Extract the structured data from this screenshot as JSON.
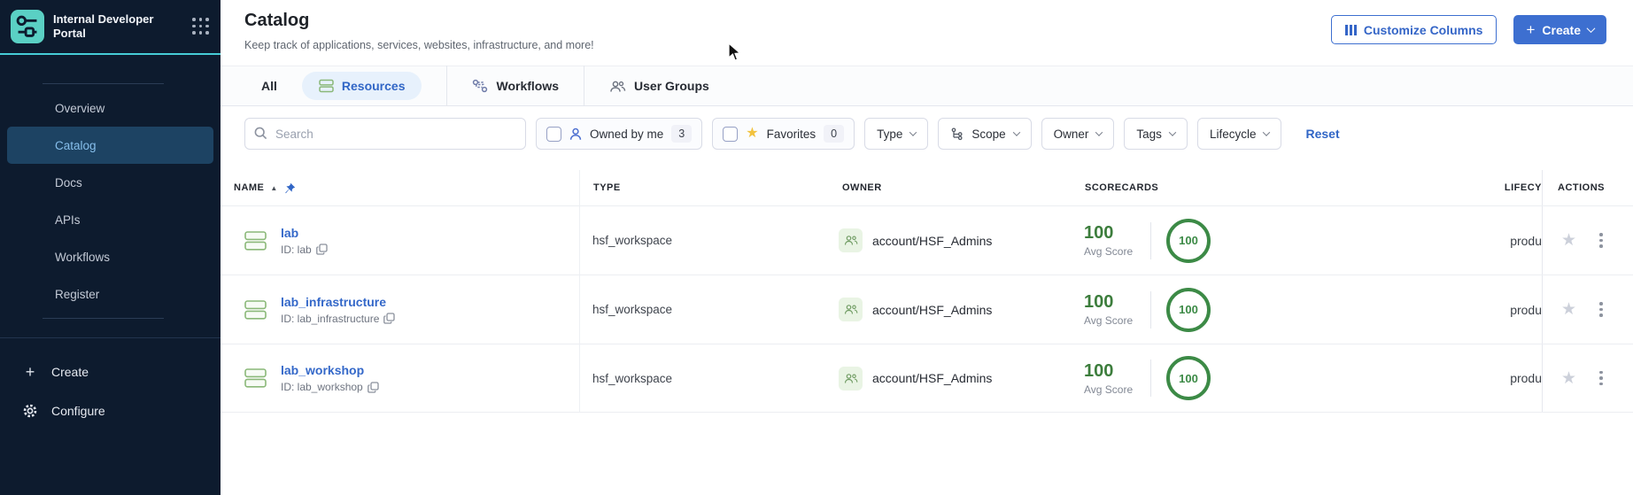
{
  "colors": {
    "sidebar_bg": "#0d1b2e",
    "accent_teal": "#46ccd6",
    "accent_blue": "#3d6fd0",
    "link_blue": "#3468c9",
    "score_green": "#3c8a46",
    "entity_green": "#8ab878",
    "favorite_gold": "#f2c23e"
  },
  "sidebar": {
    "title": "Internal Developer Portal",
    "items": [
      {
        "label": "Overview"
      },
      {
        "label": "Catalog"
      },
      {
        "label": "Docs"
      },
      {
        "label": "APIs"
      },
      {
        "label": "Workflows"
      },
      {
        "label": "Register"
      }
    ],
    "footer": {
      "create_label": "Create",
      "configure_label": "Configure"
    }
  },
  "header": {
    "title": "Catalog",
    "subtitle": "Keep track of applications, services, websites, infrastructure, and more!",
    "customize_columns_label": "Customize Columns",
    "create_label": "Create"
  },
  "tabs": [
    {
      "label": "All"
    },
    {
      "label": "Resources"
    },
    {
      "label": "Workflows"
    },
    {
      "label": "User Groups"
    }
  ],
  "filters": {
    "search_placeholder": "Search",
    "owned_by_me": {
      "label": "Owned by me",
      "count": "3"
    },
    "favorites": {
      "label": "Favorites",
      "count": "0"
    },
    "dropdowns": [
      {
        "label": "Type"
      },
      {
        "label": "Scope"
      },
      {
        "label": "Owner"
      },
      {
        "label": "Tags"
      },
      {
        "label": "Lifecycle"
      }
    ],
    "reset_label": "Reset"
  },
  "table": {
    "headers": {
      "name": "NAME",
      "type": "TYPE",
      "owner": "OWNER",
      "scorecards": "SCORECARDS",
      "lifecycle": "LIFECY",
      "actions": "ACTIONS"
    },
    "rows": [
      {
        "name": "lab",
        "id": "ID: lab",
        "type": "hsf_workspace",
        "owner": "account/HSF_Admins",
        "avg_score": "100",
        "avg_label": "Avg Score",
        "ring_score": "100",
        "lifecycle": "produ"
      },
      {
        "name": "lab_infrastructure",
        "id": "ID: lab_infrastructure",
        "type": "hsf_workspace",
        "owner": "account/HSF_Admins",
        "avg_score": "100",
        "avg_label": "Avg Score",
        "ring_score": "100",
        "lifecycle": "produ"
      },
      {
        "name": "lab_workshop",
        "id": "ID: lab_workshop",
        "type": "hsf_workspace",
        "owner": "account/HSF_Admins",
        "avg_score": "100",
        "avg_label": "Avg Score",
        "ring_score": "100",
        "lifecycle": "produ"
      }
    ]
  }
}
